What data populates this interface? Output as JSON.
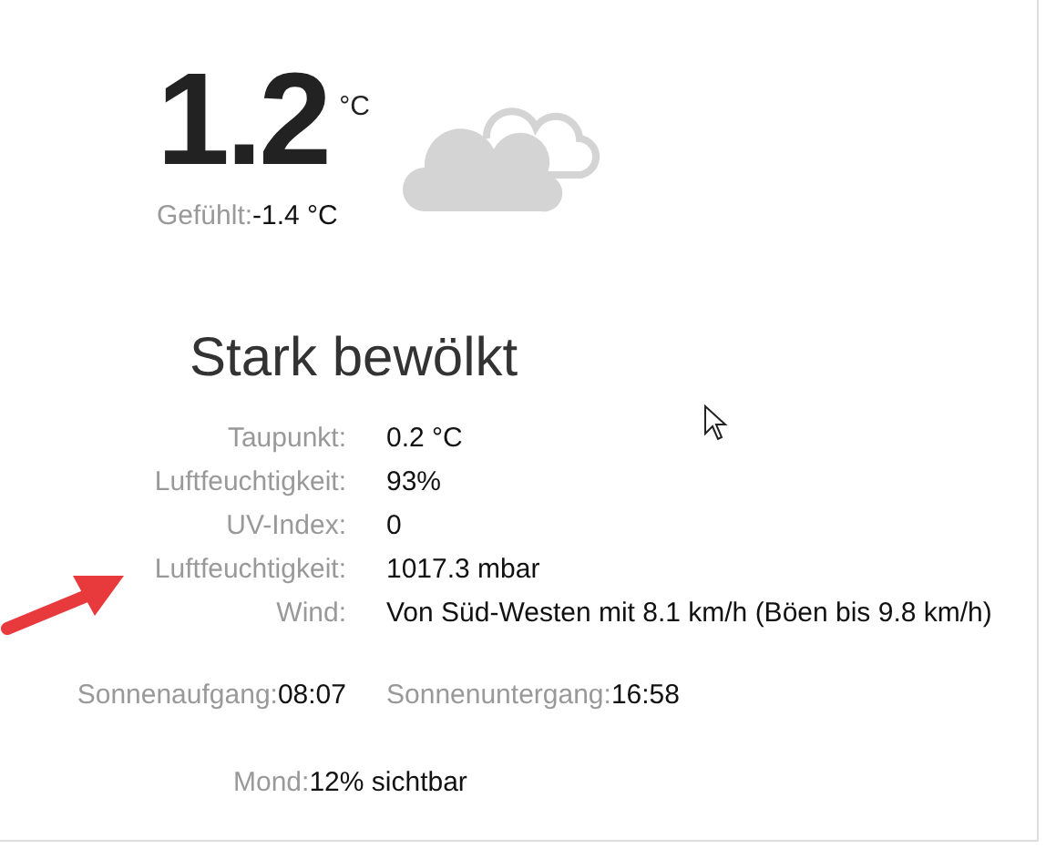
{
  "current": {
    "temperature": "1.2",
    "unit": "°C",
    "feels_label": "Gefühlt:",
    "feels_value": "-1.4 °C"
  },
  "condition": "Stark bewölkt",
  "details": [
    {
      "label": "Taupunkt:",
      "value": "0.2 °C"
    },
    {
      "label": "Luftfeuchtigkeit:",
      "value": "93%"
    },
    {
      "label": "UV-Index:",
      "value": "0"
    },
    {
      "label": "Luftfeuchtigkeit:",
      "value": "1017.3 mbar"
    },
    {
      "label": "Wind:",
      "value": "Von Süd-Westen mit 8.1 km/h (Böen bis 9.8 km/h)"
    }
  ],
  "sun": [
    {
      "label": "Sonnenaufgang:",
      "value": "08:07"
    },
    {
      "label": "Sonnenuntergang:",
      "value": "16:58"
    }
  ],
  "moon": {
    "label": "Mond:",
    "value": "12% sichtbar"
  }
}
